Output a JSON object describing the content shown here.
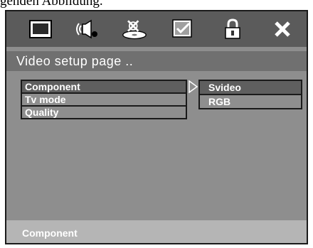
{
  "caption": "genden Abbildung.",
  "icons": [
    "tv-screen-icon",
    "speaker-icon",
    "disc-settings-icon",
    "checkbox-icon",
    "lock-icon",
    "close-icon"
  ],
  "title": "Video setup page ..",
  "menu": {
    "items": [
      "Component",
      "Tv mode",
      "Quality"
    ]
  },
  "submenu": {
    "items": [
      "Svideo",
      "RGB"
    ]
  },
  "status": "Component",
  "colors": {
    "panel": "#8e8e8e",
    "icon_bar": "#5b5b5b",
    "title_bar": "#707070",
    "selected": "#5f5f5f",
    "status_bar": "#b5b5b5"
  }
}
